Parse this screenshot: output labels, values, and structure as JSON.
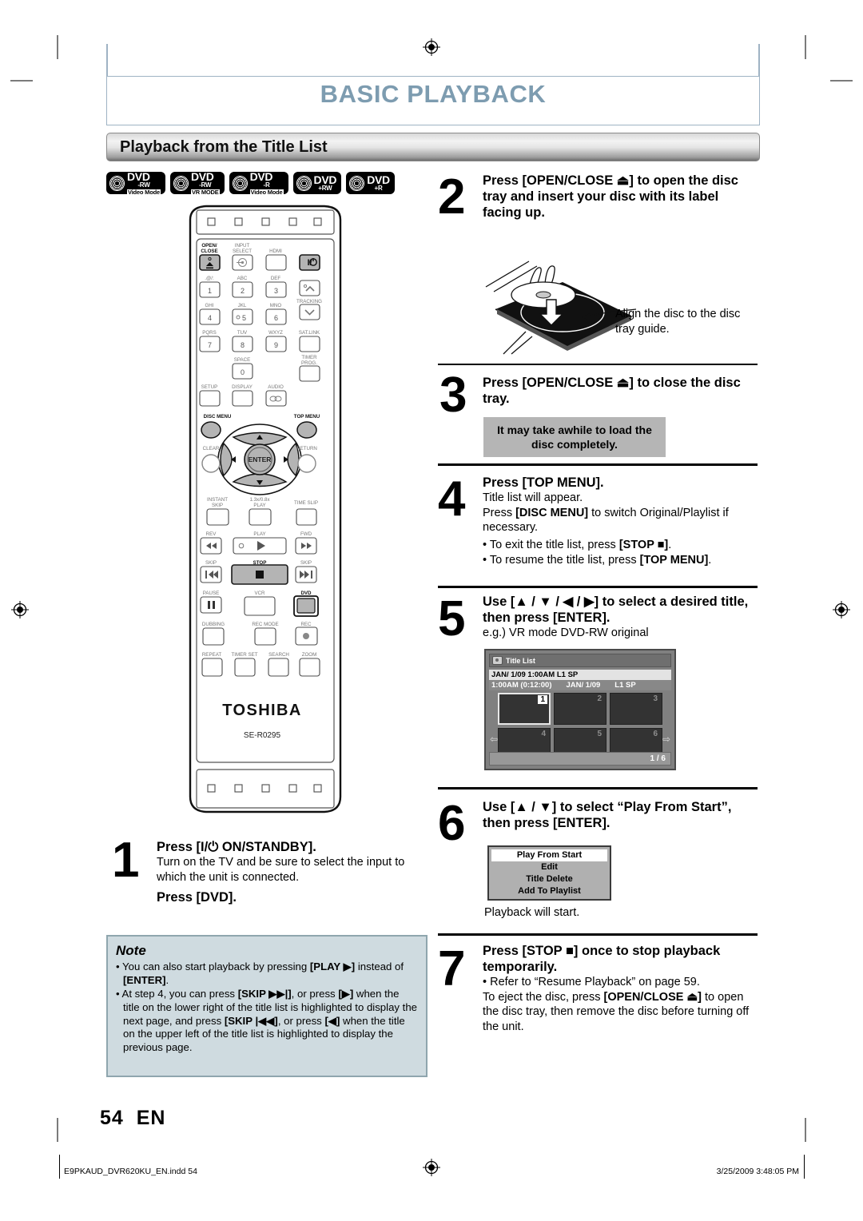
{
  "document": {
    "chapter_title": "BASIC PLAYBACK",
    "section_title": "Playback from the Title List",
    "page_number": "54",
    "page_language": "EN"
  },
  "disc_badges": [
    {
      "name": "DVD",
      "line2": "-RW",
      "line3": "Video Mode"
    },
    {
      "name": "DVD",
      "line2": "-RW",
      "line3": "VR MODE"
    },
    {
      "name": "DVD",
      "line2": "-R",
      "line3": "Video Mode"
    },
    {
      "name": "DVD",
      "line2": "+RW",
      "line3": ""
    },
    {
      "name": "DVD",
      "line2": "+R",
      "line3": ""
    }
  ],
  "remote": {
    "brand": "TOSHIBA",
    "model": "SE-R0295",
    "buttons": [
      "OPEN/ CLOSE",
      "INPUT SELECT",
      "HDMI",
      "I/⏻",
      ".@/:",
      "ABC",
      "DEF",
      "1",
      "2",
      "3",
      "TRACKING",
      "GHI",
      "JKL",
      "MNO",
      "4",
      "5",
      "6",
      "PQRS",
      "TUV",
      "WXYZ",
      "SAT.LINK",
      "7",
      "8",
      "9",
      "SPACE",
      "0",
      "TIMER PROG.",
      "SETUP",
      "DISPLAY",
      "AUDIO",
      "DISC MENU",
      "TOP MENU",
      "ENTER",
      "CLEAR",
      "RETURN",
      "INSTANT SKIP",
      "1.3x/0.8x PLAY",
      "TIME SLIP",
      "REV",
      "PLAY",
      "FWD",
      "SKIP",
      "STOP",
      "SKIP",
      "PAUSE",
      "VCR",
      "DVD",
      "DUBBING",
      "REC MODE",
      "REC",
      "REPEAT",
      "TIMER SET",
      "SEARCH",
      "ZOOM"
    ]
  },
  "steps": [
    {
      "number": "1",
      "heading": "Press [I/⏻ ON/STANDBY].",
      "body": "Turn on the TV and be sure to select the input to which the unit is connected.",
      "heading2": "Press [DVD]."
    },
    {
      "number": "2",
      "heading": "Press [OPEN/CLOSE ⏏] to open the disc tray and insert your disc with its label facing up.",
      "caption": "Align the disc to the disc tray guide."
    },
    {
      "number": "3",
      "heading": "Press [OPEN/CLOSE ⏏] to close the disc tray.",
      "callout": "It may take awhile to load the disc completely."
    },
    {
      "number": "4",
      "heading": "Press [TOP MENU].",
      "line1": "Title list will appear.",
      "line2_a": "Press ",
      "line2_b": "[DISC MENU]",
      "line2_c": " to switch Original/Playlist if necessary.",
      "bullets": [
        {
          "a": "• To exit the title list, press ",
          "b": "[STOP ■]",
          "c": "."
        },
        {
          "a": "• To resume the title list, press ",
          "b": "[TOP MENU]",
          "c": "."
        }
      ]
    },
    {
      "number": "5",
      "heading": "Use [▲ / ▼ / ◀ / ▶] to select a desired title, then press [ENTER].",
      "example": "e.g.) VR mode DVD-RW original"
    },
    {
      "number": "6",
      "heading": "Use [▲ / ▼] to select “Play From Start”, then press [ENTER].",
      "after": "Playback will start."
    },
    {
      "number": "7",
      "heading": "Press [STOP ■] once to stop playback temporarily.",
      "bullet": "• Refer to “Resume Playback” on page 59.",
      "body_a": "To eject the disc, press ",
      "body_b": "[OPEN/CLOSE ⏏]",
      "body_c": " to open the disc tray, then remove the disc before turning off the unit."
    }
  ],
  "title_list_osd": {
    "header": "Title List",
    "info_row": "JAN/ 1/09 1:00AM  L1  SP",
    "detail_time": "1:00AM (0:12:00)",
    "detail_date": "JAN/ 1/09",
    "detail_mode": "L1  SP",
    "thumbnails": [
      "1",
      "2",
      "3",
      "4",
      "5",
      "6"
    ],
    "selected_index": 0,
    "page_indicator": "1 / 6",
    "arrow_left": "⇦",
    "arrow_right": "⇨"
  },
  "popup_menu": {
    "items": [
      "Play From Start",
      "Edit",
      "Title Delete",
      "Add To Playlist"
    ],
    "highlighted_index": 0
  },
  "note": {
    "title": "Note",
    "items": [
      {
        "a": "• You can also start playback by pressing ",
        "b": "[PLAY ▶]",
        "c": " instead of ",
        "d": "[ENTER]",
        "e": "."
      },
      {
        "a": "• At step 4, you can press ",
        "b": "[SKIP ▶▶|]",
        "c": ", or press ",
        "d": "[▶]",
        "e": " when the title on the lower right of the title list is highlighted to display the next page, and press ",
        "f": "[SKIP |◀◀]",
        "g": ", or press ",
        "h": "[◀]",
        "i": " when the title on the upper left of the title list is highlighted to display the previous page."
      }
    ]
  },
  "footer": {
    "file_name": "E9PKAUD_DVR620KU_EN.indd   54",
    "timestamp": "3/25/2009   3:48:05 PM"
  },
  "colors": {
    "chapter_title": "#7d9cb0",
    "note_bg": "#cfdbe0",
    "note_border": "#8fa6ae",
    "callout_bg": "#b5b5b5"
  }
}
